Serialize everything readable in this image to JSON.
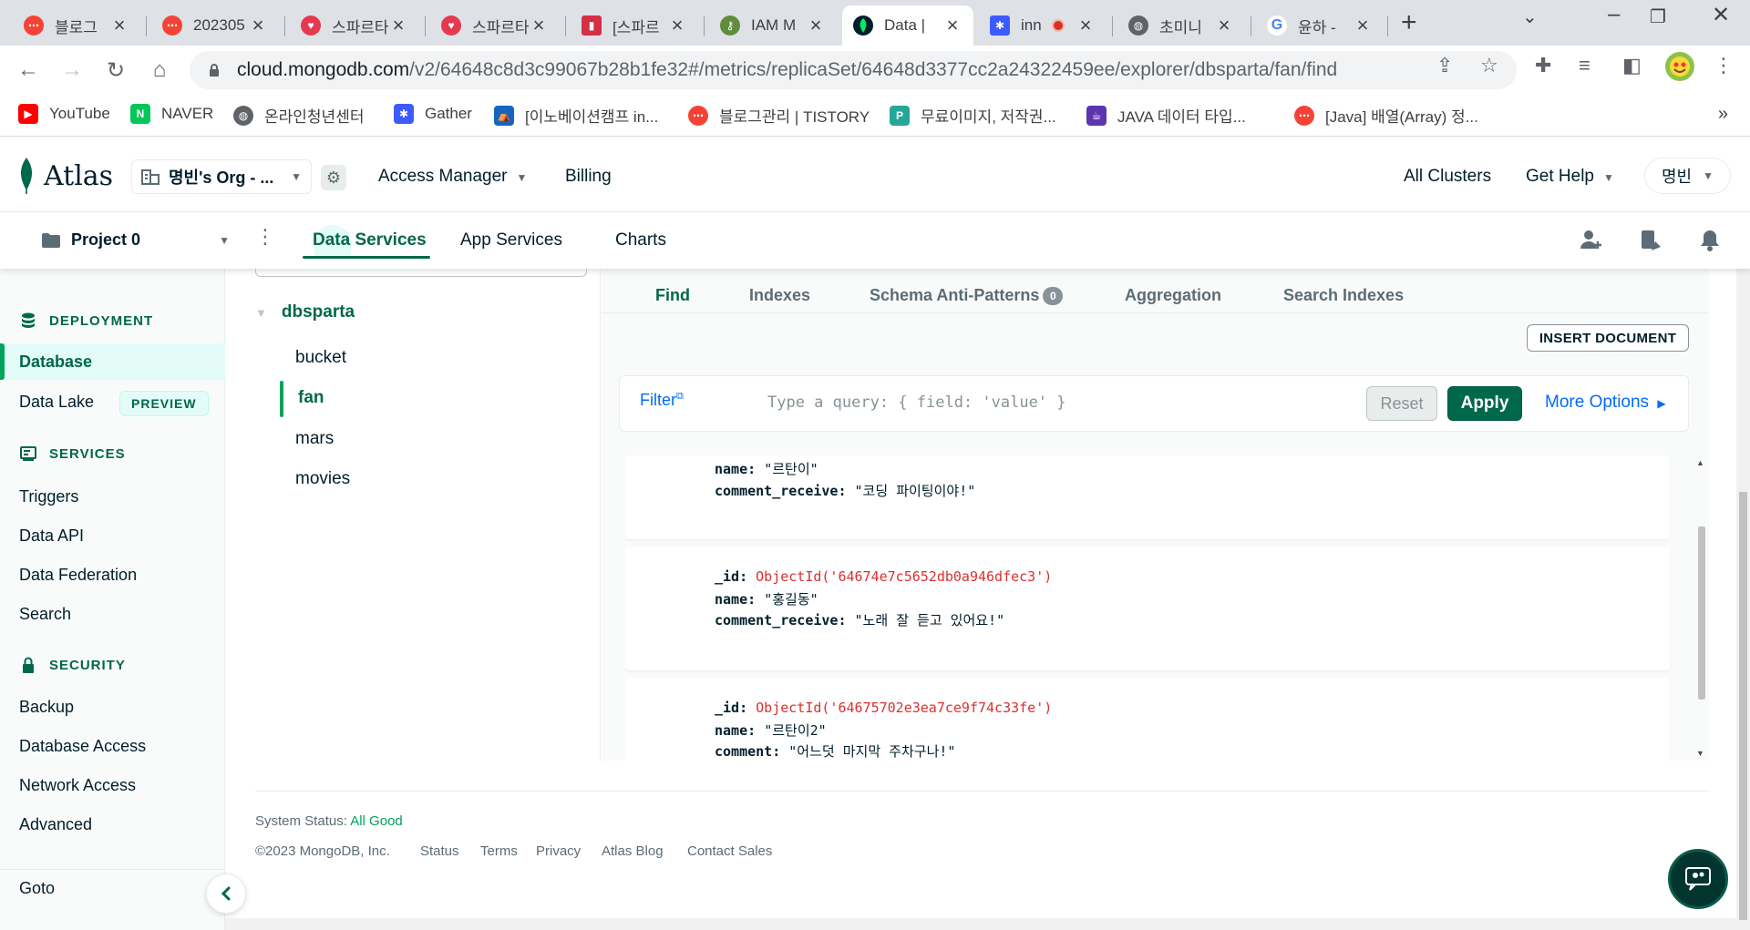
{
  "browser": {
    "tabs": [
      {
        "title": "블로그",
        "icon_color": "#f44336",
        "icon": "tistory-icon"
      },
      {
        "title": "202305",
        "icon_color": "#f44336",
        "icon": "tistory-icon"
      },
      {
        "title": "스파르타",
        "icon_color": "#e53950",
        "icon": "sparta-icon"
      },
      {
        "title": "스파르타",
        "icon_color": "#e53950",
        "icon": "sparta-icon"
      },
      {
        "title": "[스파르",
        "icon_color": "#d32f45",
        "icon": "book-icon"
      },
      {
        "title": "IAM M",
        "icon_color": "#5f8d3b",
        "icon": "key-icon"
      },
      {
        "title": "Data | ",
        "icon_color": "#001e2b",
        "icon": "mongodb-leaf-icon"
      },
      {
        "title": "inn",
        "icon_color": "#3d5afe",
        "icon": "innovation-icon"
      },
      {
        "title": "초미니",
        "icon_color": "#5f6368",
        "icon": "globe-icon"
      },
      {
        "title": "윤하 - ",
        "icon_color": "#4285f4",
        "icon": "google-icon"
      }
    ],
    "url_host": "cloud.mongodb.com",
    "url_path": "/v2/64648c8d3c99067b28b1fe32#/metrics/replicaSet/64648d3377cc2a24322459ee/explorer/dbsparta/fan/find",
    "bookmarks": [
      {
        "label": "YouTube",
        "color": "#ff0000",
        "icon": "youtube-icon"
      },
      {
        "label": "NAVER",
        "color": "#03c75a",
        "icon": "naver-icon"
      },
      {
        "label": "온라인청년센터",
        "color": "#5f6368",
        "icon": "globe-icon"
      },
      {
        "label": "Gather",
        "color": "#3d5afe",
        "icon": "gather-icon"
      },
      {
        "label": "[이노베이션캠프 in...",
        "color": "#1565c0",
        "icon": "camp-icon"
      },
      {
        "label": "블로그관리 | TISTORY",
        "color": "#f44336",
        "icon": "tistory-icon"
      },
      {
        "label": "무료이미지, 저작권...",
        "color": "#26a69a",
        "icon": "image-site-icon"
      },
      {
        "label": "JAVA 데이터 타입...",
        "color": "#5e35b1",
        "icon": "java-icon"
      },
      {
        "label": "[Java] 배열(Array) 정...",
        "color": "#f44336",
        "icon": "tistory-icon"
      }
    ]
  },
  "atlas": {
    "logo_text": "Atlas",
    "org_name": "명빈's Org - ...",
    "nav": {
      "access_manager": "Access Manager",
      "billing": "Billing",
      "all_clusters": "All Clusters",
      "get_help": "Get Help",
      "user": "명빈"
    },
    "project_name": "Project 0",
    "service_tabs": [
      "Data Services",
      "App Services",
      "Charts"
    ]
  },
  "sidebar": {
    "deployment": {
      "title": "DEPLOYMENT",
      "items": [
        "Database",
        "Data Lake"
      ],
      "preview_badge": "PREVIEW"
    },
    "services": {
      "title": "SERVICES",
      "items": [
        "Triggers",
        "Data API",
        "Data Federation",
        "Search"
      ]
    },
    "security": {
      "title": "SECURITY",
      "items": [
        "Backup",
        "Database Access",
        "Network Access",
        "Advanced"
      ]
    },
    "goto": "Goto"
  },
  "tree": {
    "database": "dbsparta",
    "collections": [
      "bucket",
      "fan",
      "mars",
      "movies"
    ],
    "active_collection": "fan"
  },
  "explorer": {
    "tabs": [
      "Find",
      "Indexes",
      "Schema Anti-Patterns",
      "Aggregation",
      "Search Indexes"
    ],
    "anti_pattern_count": "0",
    "insert_document": "INSERT DOCUMENT",
    "filter_label": "Filter",
    "query_placeholder": "Type a query: { field: 'value' }",
    "reset": "Reset",
    "apply": "Apply",
    "more_options": "More Options"
  },
  "documents": [
    {
      "name_key": "name:",
      "name_val": "\"르탄이\"",
      "c_key": "comment_receive:",
      "c_val": "\"코딩 파이팅이야!\""
    },
    {
      "id_key": "_id:",
      "id_val": "ObjectId('64674e7c5652db0a946dfec3')",
      "name_key": "name:",
      "name_val": "\"홍길동\"",
      "c_key": "comment_receive:",
      "c_val": "\"노래 잘 듣고 있어요!\""
    },
    {
      "id_key": "_id:",
      "id_val": "ObjectId('64675702e3ea7ce9f74c33fe')",
      "name_key": "name:",
      "name_val": "\"르탄이2\"",
      "c_key": "comment:",
      "c_val": "\"어느덧 마지막 주차구나!\""
    }
  ],
  "footer": {
    "status_label": "System Status:",
    "status_value": "All Good",
    "copyright": "©2023 MongoDB, Inc.",
    "links": [
      "Status",
      "Terms",
      "Privacy",
      "Atlas Blog",
      "Contact Sales"
    ]
  },
  "colors": {
    "brand_green": "#00684a",
    "accent_green": "#00a35c",
    "link_blue": "#016bf8",
    "oid_red": "#db3030"
  }
}
